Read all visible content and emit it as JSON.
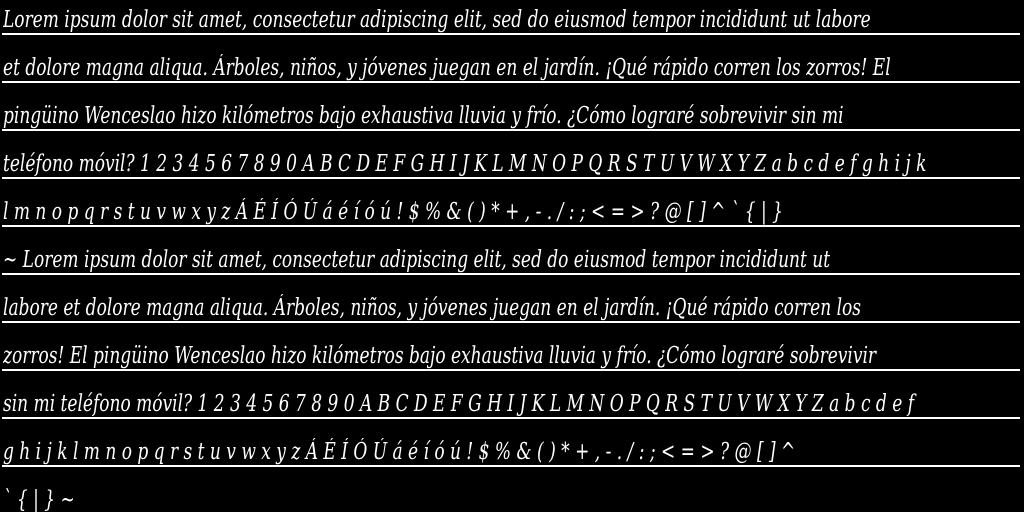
{
  "sample": {
    "lines": [
      "Lorem ipsum dolor sit amet, consectetur adipiscing elit, sed do eiusmod tempor incididunt ut labore",
      "et dolore magna aliqua. Árboles, niños, y jóvenes juegan en el jardín. ¡Qué rápido corren los zorros! El",
      "pingüino Wenceslao hizo kilómetros bajo exhaustiva lluvia y frío. ¿Cómo lograré sobrevivir sin mi",
      "teléfono móvil? 1 2 3 4 5 6 7 8 9 0 A B C D E F G H I J K L M N O P Q R S T U V W X Y Z a b c d e f g h i j k",
      "l m n o p q r s t u v w x y z Á É Í Ó Ú á é í ó ú ! $ % & ( ) * + , - . / : ; < = > ? @ [ ] ^   ` { | }",
      "~ Lorem ipsum dolor sit amet, consectetur adipiscing elit, sed do eiusmod tempor incididunt ut",
      "labore et dolore magna aliqua. Árboles, niños, y jóvenes juegan en el jardín. ¡Qué rápido corren los",
      "zorros! El pingüino Wenceslao hizo kilómetros bajo exhaustiva lluvia y frío. ¿Cómo lograré sobrevivir",
      "sin mi teléfono móvil? 1 2 3 4 5 6 7 8 9 0 A B C D E F G H I J K L M N O P Q R S T U V W X Y Z a b c d e f",
      "g h i j k l m n o p q r s t u v w x y z Á É Í Ó Ú á é í ó ú ! $ % & ( ) * + , - . / : ; < = > ? @ [ ] ^",
      "` { | } ~"
    ]
  },
  "colors": {
    "background": "#000000",
    "text": "#ffffff"
  }
}
